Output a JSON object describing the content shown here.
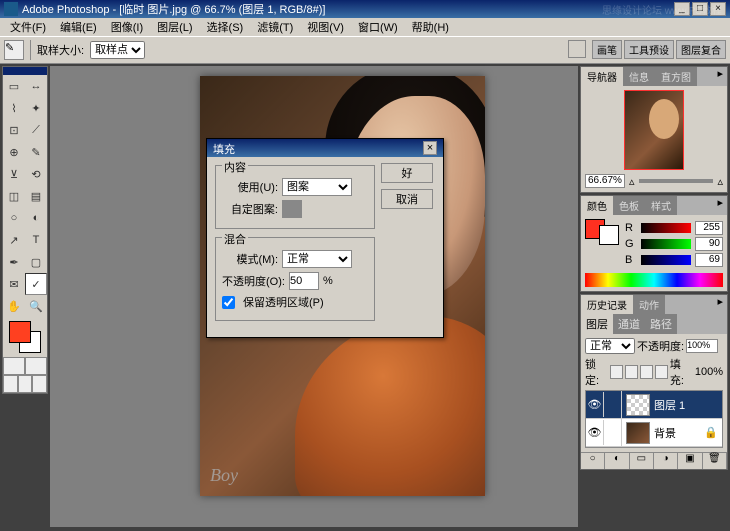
{
  "title": "Adobe Photoshop - [临时 图片.jpg @ 66.7% (图层 1, RGB/8#)]",
  "watermark": "思缘设计论坛   www.PS教程",
  "menu": {
    "file": "文件(F)",
    "edit": "编辑(E)",
    "image": "图像(I)",
    "layer": "图层(L)",
    "select": "选择(S)",
    "filter": "滤镜(T)",
    "view": "视图(V)",
    "window": "窗口(W)",
    "help": "帮助(H)"
  },
  "optbar": {
    "label1": "取样大小:",
    "label2": "取样点"
  },
  "optTabs": {
    "a": "画笔",
    "b": "工具预设",
    "c": "图层复合"
  },
  "dialog": {
    "title": "填充",
    "ok": "好",
    "cancel": "取消",
    "grp1": "内容",
    "use": "使用(U):",
    "useVal": "图案",
    "custom": "自定图案:",
    "grp2": "混合",
    "mode": "模式(M):",
    "modeVal": "正常",
    "opacity": "不透明度(O):",
    "opacityVal": "50",
    "pct": "%",
    "preserve": "保留透明区域(P)"
  },
  "nav": {
    "tab1": "导航器",
    "tab2": "信息",
    "tab3": "直方图",
    "zoom": "66.67%"
  },
  "color": {
    "tab1": "颜色",
    "tab2": "色板",
    "tab3": "样式",
    "R": "R",
    "G": "G",
    "B": "B",
    "rVal": "255",
    "gVal": "90",
    "bVal": "69"
  },
  "history": {
    "tab1": "历史记录",
    "tab2": "动作"
  },
  "layers": {
    "tab1": "图层",
    "tab2": "通道",
    "tab3": "路径",
    "blend": "正常",
    "opacityLbl": "不透明度:",
    "opacityVal": "100%",
    "lockLbl": "锁定:",
    "fillLbl": "填充:",
    "fillVal": "100%",
    "layer1": "图层 1",
    "bgLayer": "背景"
  },
  "docWater": "Boy"
}
